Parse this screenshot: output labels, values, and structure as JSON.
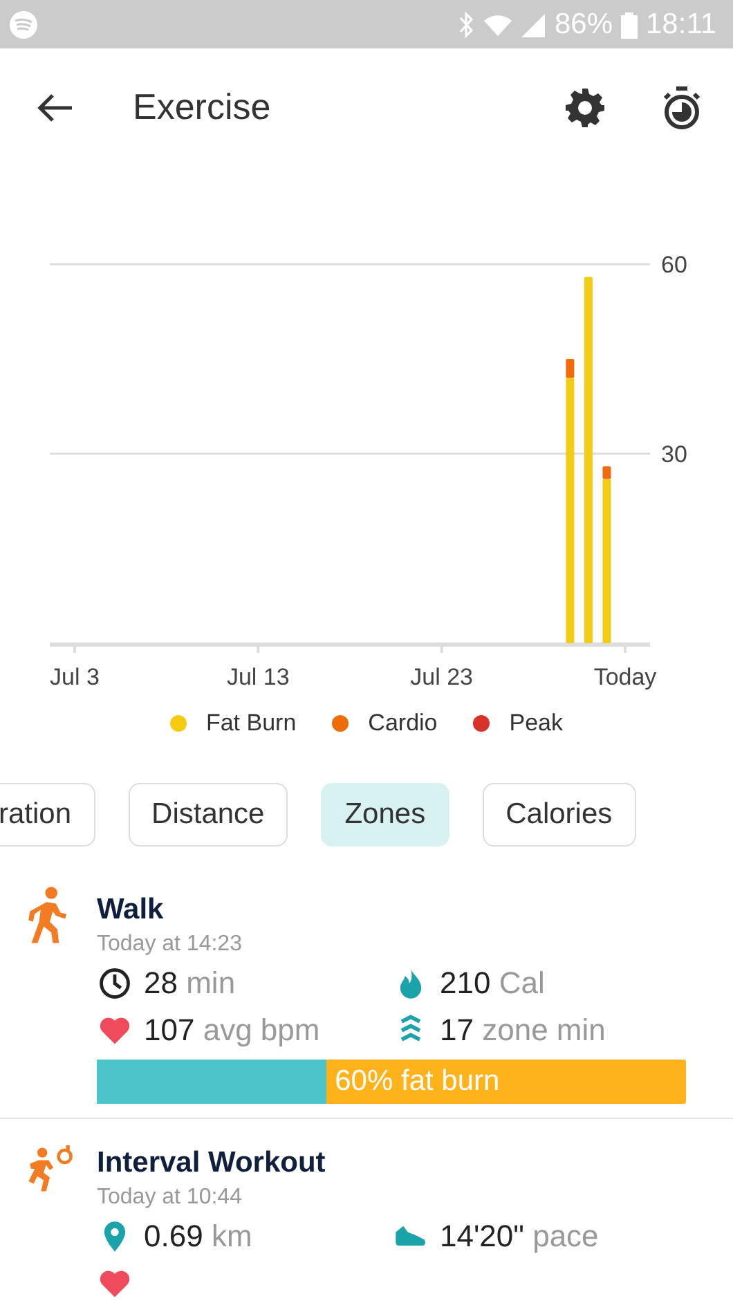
{
  "status_bar": {
    "battery": "86%",
    "time": "18:11"
  },
  "header": {
    "title": "Exercise"
  },
  "chart": {
    "chart_data": {
      "type": "bar",
      "stacked": true,
      "ylim": [
        0,
        60
      ],
      "yticks": [
        30,
        60
      ],
      "categories": [
        "Jul 3",
        null,
        null,
        null,
        null,
        null,
        null,
        null,
        null,
        null,
        "Jul 13",
        null,
        null,
        null,
        null,
        null,
        null,
        null,
        null,
        null,
        "Jul 23",
        null,
        null,
        null,
        null,
        null,
        null,
        null,
        null,
        null,
        "Today"
      ],
      "series": [
        {
          "name": "Fat Burn",
          "color": "#f5cc14",
          "values": [
            null,
            null,
            null,
            null,
            null,
            null,
            null,
            null,
            null,
            null,
            null,
            null,
            null,
            null,
            null,
            null,
            null,
            null,
            null,
            null,
            null,
            null,
            null,
            null,
            null,
            null,
            null,
            42,
            58,
            26,
            null
          ]
        },
        {
          "name": "Cardio",
          "color": "#f06c0a",
          "values": [
            null,
            null,
            null,
            null,
            null,
            null,
            null,
            null,
            null,
            null,
            null,
            null,
            null,
            null,
            null,
            null,
            null,
            null,
            null,
            null,
            null,
            null,
            null,
            null,
            null,
            null,
            null,
            3,
            0,
            2,
            null
          ]
        },
        {
          "name": "Peak",
          "color": "#d8322a",
          "values": [
            null,
            null,
            null,
            null,
            null,
            null,
            null,
            null,
            null,
            null,
            null,
            null,
            null,
            null,
            null,
            null,
            null,
            null,
            null,
            null,
            null,
            null,
            null,
            null,
            null,
            null,
            null,
            0,
            0,
            0,
            null
          ]
        }
      ]
    }
  },
  "tabs": [
    {
      "label": "ration",
      "selected": false
    },
    {
      "label": "Distance",
      "selected": false
    },
    {
      "label": "Zones",
      "selected": true
    },
    {
      "label": "Calories",
      "selected": false
    }
  ],
  "workouts": [
    {
      "kind": "walk",
      "name": "Walk",
      "time": "Today at 14:23",
      "stats": [
        {
          "kind": "duration",
          "value": "28",
          "unit": "min"
        },
        {
          "kind": "calories",
          "value": "210",
          "unit": "Cal"
        },
        {
          "kind": "heart",
          "value": "107",
          "unit": "avg bpm"
        },
        {
          "kind": "zone",
          "value": "17",
          "unit": "zone min"
        }
      ],
      "zone_bar": {
        "level": 0.39,
        "label": "60% fat burn"
      }
    },
    {
      "kind": "interval",
      "name": "Interval Workout",
      "time": "Today at 10:44",
      "stats": [
        {
          "kind": "distance",
          "value": "0.69",
          "unit": "km"
        },
        {
          "kind": "pace",
          "value": "14'20\"",
          "unit": "pace"
        },
        {
          "kind": "heart"
        }
      ]
    }
  ]
}
